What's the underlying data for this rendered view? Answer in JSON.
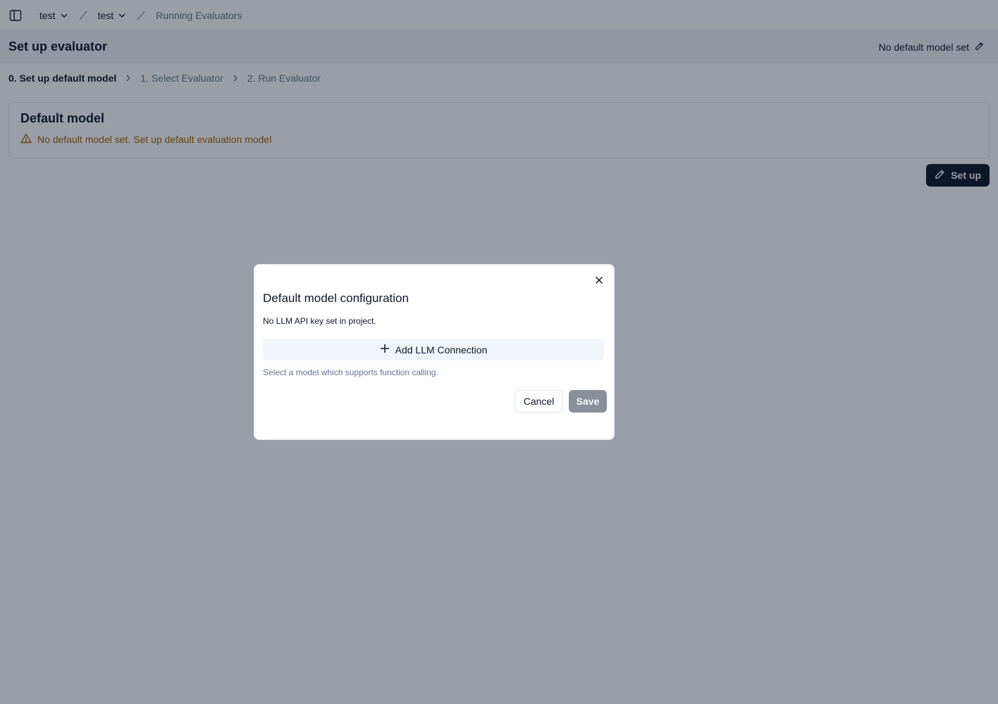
{
  "topbar": {
    "breadcrumb": [
      {
        "label": "test",
        "has_dropdown": true
      },
      {
        "label": "test",
        "has_dropdown": true
      },
      {
        "label": "Running Evaluators",
        "has_dropdown": false
      }
    ]
  },
  "header": {
    "title": "Set up evaluator",
    "default_model_status": "No default model set"
  },
  "steps": [
    {
      "label": "0. Set up default model",
      "active": true
    },
    {
      "label": "1. Select Evaluator",
      "active": false
    },
    {
      "label": "2. Run Evaluator",
      "active": false
    }
  ],
  "card": {
    "title": "Default model",
    "warning": "No default model set. Set up default evaluation model"
  },
  "setup_button": {
    "label": "Set up"
  },
  "modal": {
    "title": "Default model configuration",
    "description": "No LLM API key set in project.",
    "add_connection_label": "Add LLM Connection",
    "hint": "Select a model which supports function calling.",
    "cancel_label": "Cancel",
    "save_label": "Save"
  },
  "colors": {
    "primary": "#0f172a",
    "muted": "#64748b",
    "warning": "#a16207",
    "overlay": "rgba(15,23,42,0.42)",
    "save_disabled": "#8a8f99"
  },
  "icons": [
    "sidebar-toggle-icon",
    "chevron-down-icon",
    "slash-icon",
    "pencil-icon",
    "chevron-right-icon",
    "warning-triangle-icon",
    "close-icon",
    "plus-icon"
  ]
}
